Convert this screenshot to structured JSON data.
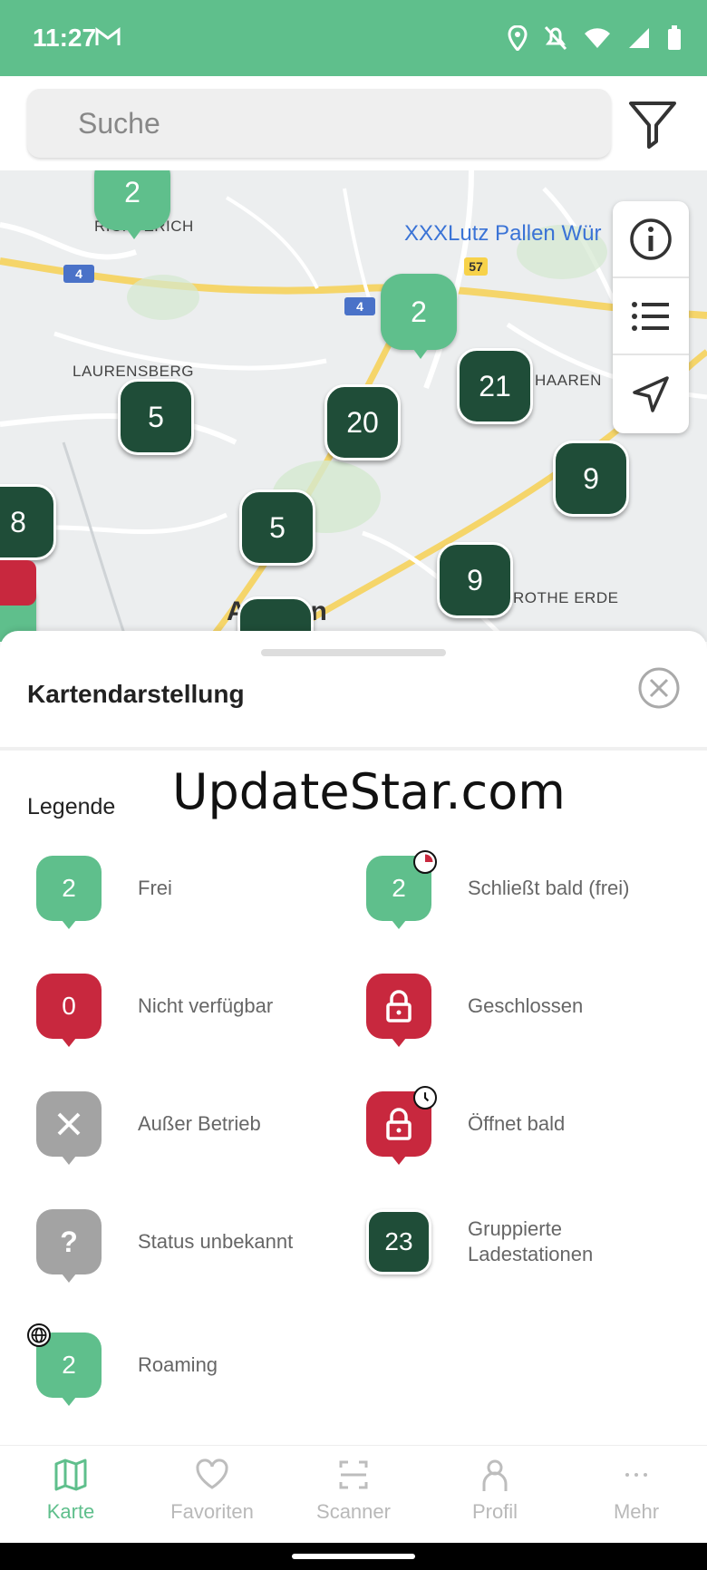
{
  "status_bar": {
    "time": "11:27"
  },
  "search": {
    "placeholder": "Suche"
  },
  "map": {
    "labels": [
      "RICHTERICH",
      "LAURENSBERG",
      "HAAREN",
      "ROTHE ERDE",
      "Aachen"
    ],
    "poi": "XXXLutz Pallen Wür",
    "route_signs": [
      "4",
      "4",
      "57"
    ],
    "clusters": [
      "5",
      "20",
      "21",
      "9",
      "5",
      "9",
      "8"
    ],
    "free_pins": [
      "2",
      "2"
    ]
  },
  "sheet": {
    "title": "Kartendarstellung",
    "watermark": "UpdateStar.com",
    "legend_title": "Legende",
    "items": [
      {
        "marker": "2",
        "label": "Frei"
      },
      {
        "marker": "2",
        "label": "Schließt bald (frei)"
      },
      {
        "marker": "0",
        "label": "Nicht verfügbar"
      },
      {
        "marker": "lock-icon",
        "label": "Geschlossen"
      },
      {
        "marker": "x-icon",
        "label": "Außer Betrieb"
      },
      {
        "marker": "lock-icon",
        "label": "Öffnet bald"
      },
      {
        "marker": "?",
        "label": "Status unbekannt"
      },
      {
        "marker": "23",
        "label": "Gruppierte Ladestationen"
      },
      {
        "marker": "2",
        "label": "Roaming"
      }
    ]
  },
  "nav": [
    {
      "label": "Karte",
      "icon": "map-icon",
      "active": true
    },
    {
      "label": "Favoriten",
      "icon": "heart-icon"
    },
    {
      "label": "Scanner",
      "icon": "scanner-icon"
    },
    {
      "label": "Profil",
      "icon": "profile-icon"
    },
    {
      "label": "Mehr",
      "icon": "more-icon"
    }
  ],
  "colors": {
    "accent": "#5fbf8c",
    "cluster": "#1f4d38",
    "unavailable": "#c8283e",
    "unknown": "#a3a3a3"
  }
}
